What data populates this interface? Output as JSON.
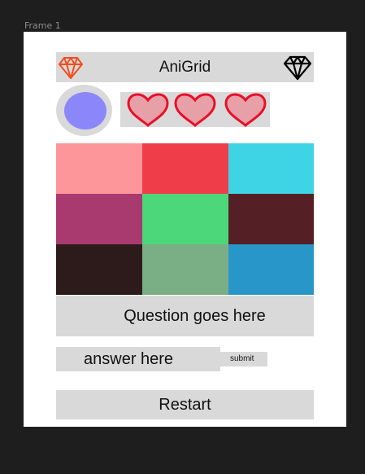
{
  "canvas": {
    "frame_label": "Frame 1"
  },
  "header": {
    "title": "AniGrid",
    "left_icon": "gem-outline-icon",
    "left_icon_color": "#f24e1e",
    "right_icon": "diamond-icon",
    "right_icon_color": "#000000"
  },
  "player": {
    "avatar_color": "#8b87fb",
    "lives": 3,
    "heart_fill": "#e8a0a8",
    "heart_stroke": "#e8102a"
  },
  "grid": {
    "rows": 3,
    "cols": 3,
    "colors": [
      "#fd969a",
      "#ef3e4a",
      "#3ed4e6",
      "#a93a6f",
      "#4bd77a",
      "#552025",
      "#2d1a1a",
      "#7aaf85",
      "#2996c9"
    ]
  },
  "question": {
    "text": "Question goes here"
  },
  "answer": {
    "value": "answer here",
    "submit_label": "submit"
  },
  "restart": {
    "label": "Restart"
  }
}
